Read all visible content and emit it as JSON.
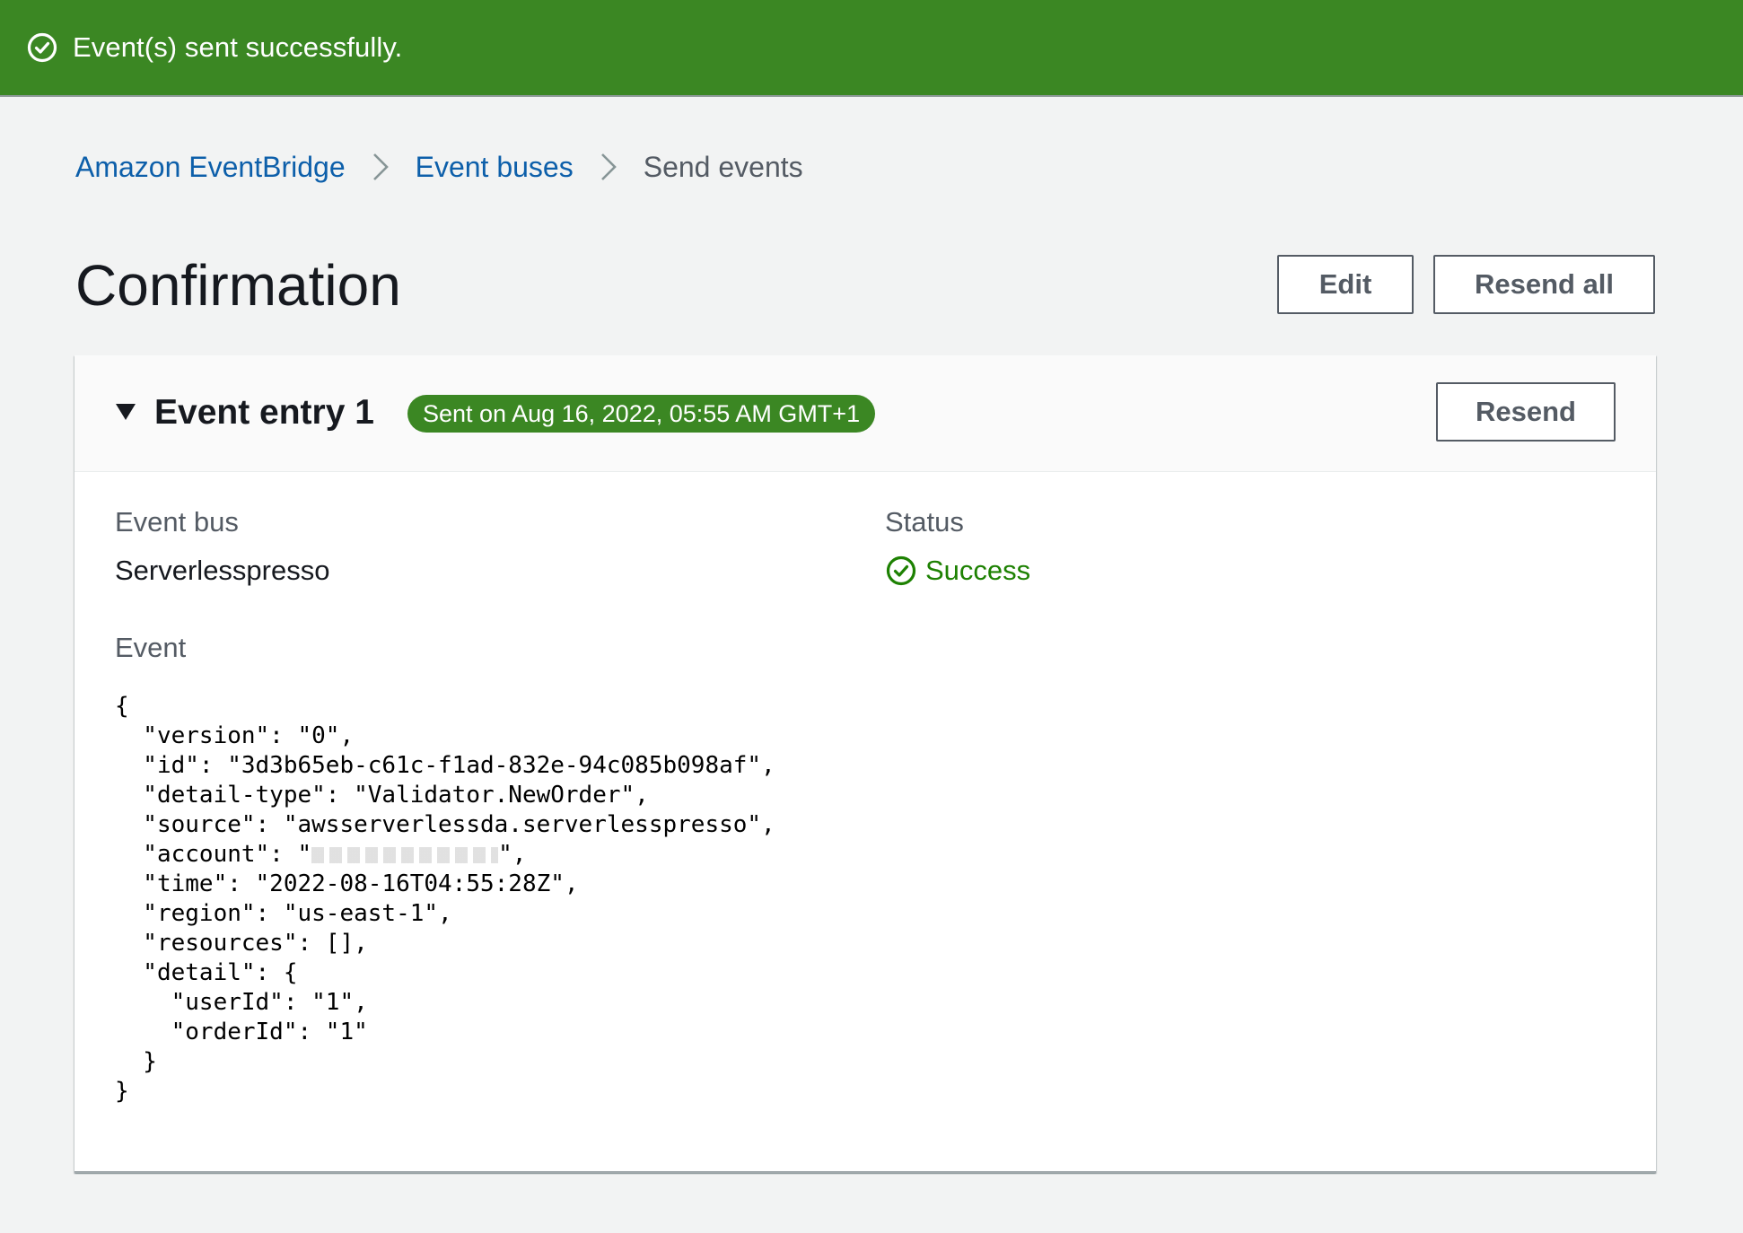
{
  "notification": {
    "message": "Event(s) sent successfully.",
    "color": "#3b8723",
    "icon": "check-circle-icon"
  },
  "breadcrumb": {
    "items": [
      {
        "label": "Amazon EventBridge",
        "link": true
      },
      {
        "label": "Event buses",
        "link": true
      },
      {
        "label": "Send events",
        "link": false
      }
    ],
    "separator_icon": "chevron-right-icon"
  },
  "page": {
    "title": "Confirmation",
    "edit_label": "Edit",
    "resend_all_label": "Resend all"
  },
  "entry": {
    "title": "Event entry 1",
    "sent_badge": "Sent on Aug 16, 2022, 05:55 AM GMT+1",
    "resend_label": "Resend",
    "expanded": true,
    "event_bus_label": "Event bus",
    "event_bus_value": "Serverlesspresso",
    "status_label": "Status",
    "status_value": "Success",
    "status_color": "#1d8102",
    "event_label": "Event",
    "event_json": {
      "line1": "{",
      "line2": "  \"version\": \"0\",",
      "line3": "  \"id\": \"3d3b65eb-c61c-f1ad-832e-94c085b098af\",",
      "line4": "  \"detail-type\": \"Validator.NewOrder\",",
      "line5_prefix": "  \"account\": \"",
      "line5_suffix": "\",",
      "line_source": "  \"source\": \"awsserverlessda.serverlesspresso\",",
      "line6": "  \"time\": \"2022-08-16T04:55:28Z\",",
      "line7": "  \"region\": \"us-east-1\",",
      "line8": "  \"resources\": [],",
      "line9": "  \"detail\": {",
      "line10": "    \"userId\": \"1\",",
      "line11": "    \"orderId\": \"1\"",
      "line12": "  }",
      "line13": "}"
    }
  }
}
